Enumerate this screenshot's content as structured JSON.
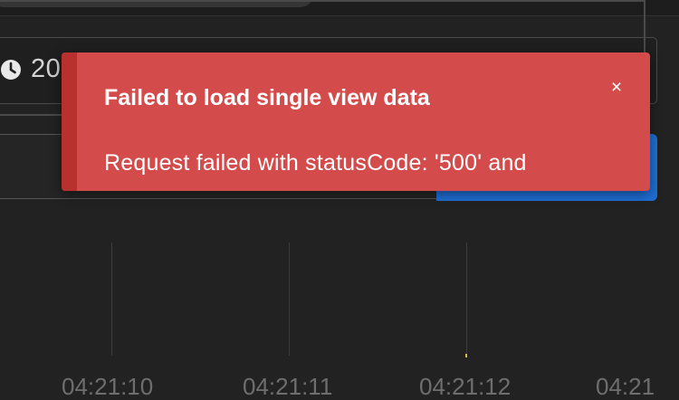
{
  "time_filter": {
    "icon": "clock-icon",
    "value_fragment": "20"
  },
  "chart": {
    "x_ticks": [
      "04:21:10",
      "04:21:11",
      "04:21:12",
      "04:21"
    ]
  },
  "toast": {
    "title": "Failed to load single view data",
    "message": "Request failed with statusCode: '500' and",
    "close_symbol": "×",
    "colors": {
      "background": "#d34b4b",
      "accent_stripe": "#b8312f"
    }
  },
  "colors": {
    "page_background": "#222222",
    "primary_button": "#1f6fd6"
  }
}
